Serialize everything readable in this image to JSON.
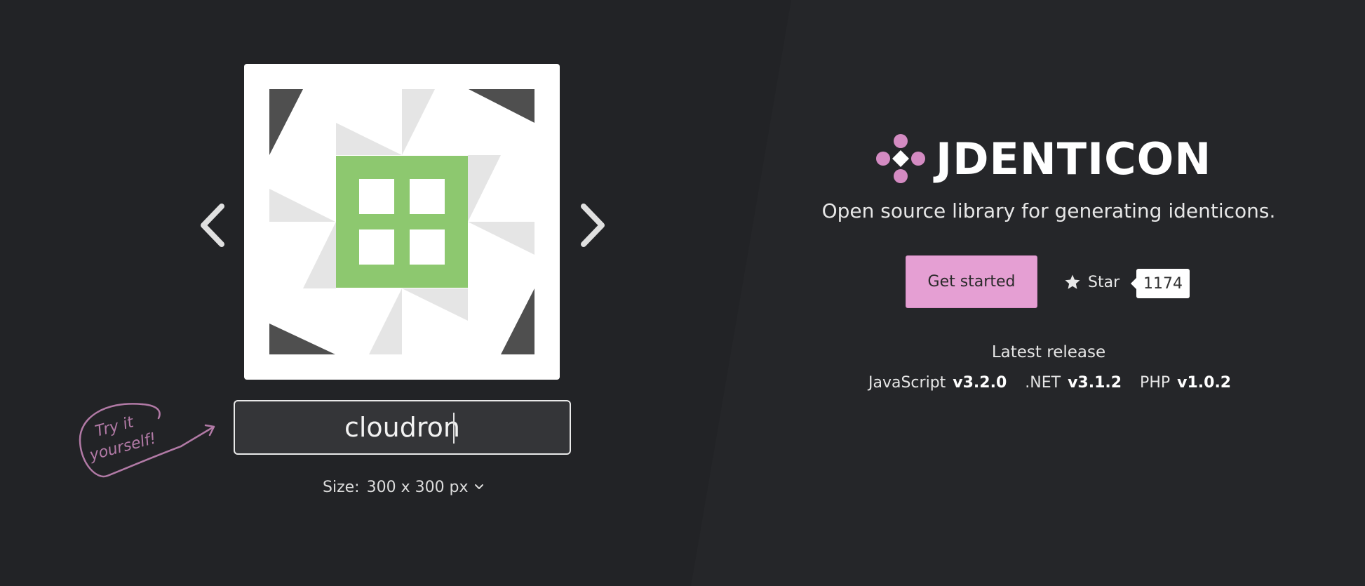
{
  "demo": {
    "input_value": "cloudron",
    "size_label": "Size:",
    "size_value": "300 x 300 px",
    "try_note": [
      "Try it",
      "yourself!"
    ],
    "identicon_colors": {
      "accent": "#8dc86f",
      "dark": "#4f4f4f",
      "light": "#e5e5e5"
    }
  },
  "hero": {
    "brand": "JDENTICON",
    "tagline": "Open source library for generating identicons.",
    "get_started": "Get started",
    "star_label": "Star",
    "star_count": "1174",
    "release_title": "Latest release",
    "releases": [
      {
        "lang": "JavaScript",
        "version": "v3.2.0"
      },
      {
        "lang": ".NET",
        "version": "v3.1.2"
      },
      {
        "lang": "PHP",
        "version": "v1.0.2"
      }
    ]
  },
  "colors": {
    "background": "#222326",
    "brand_pink": "#e59fd3",
    "logo_dot": "#d48bc2"
  }
}
